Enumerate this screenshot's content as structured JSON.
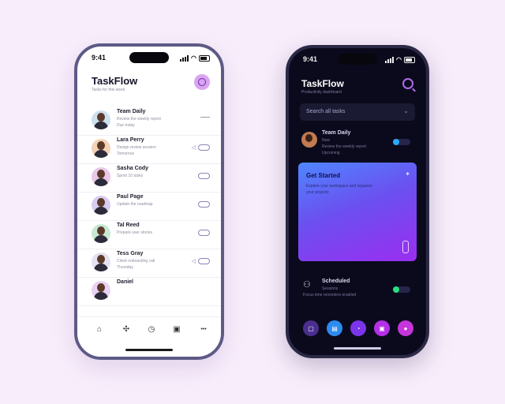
{
  "light": {
    "status_time": "9:41",
    "app_title": "TaskFlow",
    "subtitle": "Tasks for this week",
    "tasks": [
      {
        "name": "Team Daily",
        "meta1": "Review the weekly report",
        "meta2": "Due today",
        "accessory": "dash"
      },
      {
        "name": "Lara Perry",
        "meta1": "Design review session",
        "meta2": "Tomorrow",
        "accessory": "tag-arrow"
      },
      {
        "name": "Sasha Cody",
        "meta1": "Sprint 10 tasks",
        "meta2": "",
        "accessory": "tag"
      },
      {
        "name": "Paul Page",
        "meta1": "Update the roadmap",
        "meta2": "",
        "accessory": "tag"
      },
      {
        "name": "Tal Reed",
        "meta1": "Prepare user stories",
        "meta2": "",
        "accessory": "tag"
      },
      {
        "name": "Tess Gray",
        "meta1": "Client onboarding call",
        "meta2": "Thursday",
        "accessory": "tag-arrow"
      },
      {
        "name": "Daniel",
        "meta1": "",
        "meta2": "",
        "accessory": "none"
      }
    ],
    "nav": [
      {
        "icon": "home-icon",
        "glyph": "⌂"
      },
      {
        "icon": "puzzle-icon",
        "glyph": "✣"
      },
      {
        "icon": "clock-icon",
        "glyph": "◷"
      },
      {
        "icon": "calendar-icon",
        "glyph": "▣"
      },
      {
        "icon": "more-icon",
        "glyph": "•••"
      }
    ]
  },
  "dark": {
    "status_time": "9:41",
    "app_title": "TaskFlow",
    "subtitle": "Productivity dashboard",
    "search_placeholder": "Search all tasks",
    "item1": {
      "name": "Team Daily",
      "meta1": "Now",
      "meta2": "Review the weekly report",
      "meta3": "Upcoming",
      "toggle_color": "#2aa9ff"
    },
    "card": {
      "title": "Get Started",
      "line1": "Explore your workspace and organize",
      "line2": "your projects"
    },
    "item2": {
      "name": "Scheduled",
      "meta1": "Sessions",
      "meta2": "Focus time reminders enabled",
      "toggle_color": "#2be07a"
    },
    "nav": [
      {
        "icon": "inbox-icon",
        "color": "#4b2f8f",
        "glyph": "▢"
      },
      {
        "icon": "tasks-icon",
        "color": "#2c8bf0",
        "glyph": "▤"
      },
      {
        "icon": "chat-icon",
        "color": "#7a35e8",
        "glyph": "◔"
      },
      {
        "icon": "folder-icon",
        "color": "#b52fe8",
        "glyph": "▣"
      },
      {
        "icon": "profile-icon",
        "color": "#c535d9",
        "glyph": "●"
      }
    ]
  }
}
